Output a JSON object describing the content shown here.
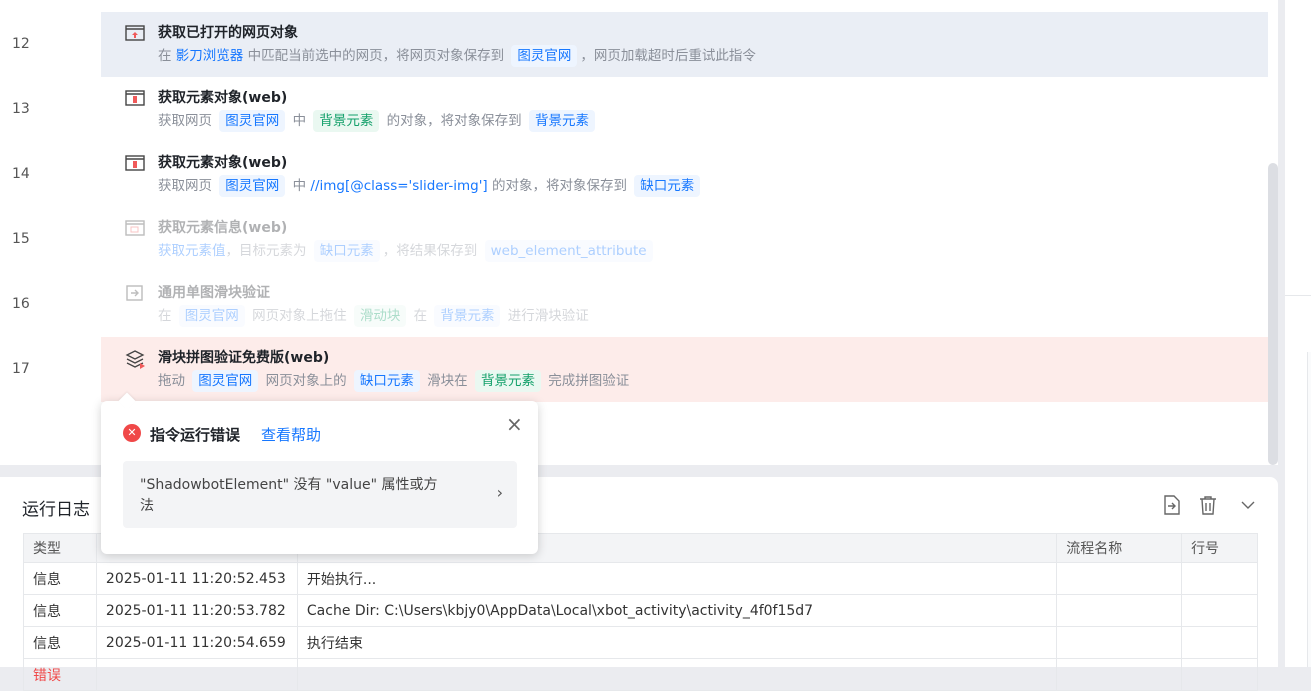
{
  "steps": [
    {
      "line": "12",
      "title": "获取已打开的网页对象",
      "desc": [
        {
          "t": "在 "
        },
        {
          "t": "影刀浏览器",
          "k": "lk"
        },
        {
          "t": " 中匹配当前选中的网页，将网页对象保存到 "
        },
        {
          "t": "图灵官网",
          "k": "tag"
        },
        {
          "t": "，网页加载超时后重试此指令"
        }
      ],
      "icon": "browser-icon",
      "state": "sel"
    },
    {
      "line": "13",
      "title": "获取元素对象(web)",
      "desc": [
        {
          "t": "获取网页 "
        },
        {
          "t": "图灵官网",
          "k": "tag"
        },
        {
          "t": " 中 "
        },
        {
          "t": "背景元素",
          "k": "tag g"
        },
        {
          "t": " 的对象，将对象保存到 "
        },
        {
          "t": "背景元素",
          "k": "tag"
        }
      ],
      "icon": "web-element-icon",
      "state": ""
    },
    {
      "line": "14",
      "title": "获取元素对象(web)",
      "desc": [
        {
          "t": "获取网页 "
        },
        {
          "t": "图灵官网",
          "k": "tag"
        },
        {
          "t": " 中 "
        },
        {
          "t": "//img[@class='slider-img']",
          "k": "lk"
        },
        {
          "t": " 的对象，将对象保存到 "
        },
        {
          "t": "缺口元素",
          "k": "tag"
        }
      ],
      "icon": "web-element-icon",
      "state": ""
    },
    {
      "line": "15",
      "title": "获取元素信息(web)",
      "desc": [
        {
          "t": "获取元素值",
          "k": "lk"
        },
        {
          "t": "，目标元素为 "
        },
        {
          "t": "缺口元素",
          "k": "tag"
        },
        {
          "t": "，将结果保存到 "
        },
        {
          "t": "web_element_attribute",
          "k": "tag"
        }
      ],
      "icon": "element-info-icon",
      "state": "dis"
    },
    {
      "line": "16",
      "title": "通用单图滑块验证",
      "desc": [
        {
          "t": "在 "
        },
        {
          "t": "图灵官网",
          "k": "tag"
        },
        {
          "t": " 网页对象上拖住 "
        },
        {
          "t": "滑动块",
          "k": "tag g"
        },
        {
          "t": " 在 "
        },
        {
          "t": "背景元素",
          "k": "tag"
        },
        {
          "t": " 进行滑块验证"
        }
      ],
      "icon": "slider-icon",
      "state": "dis"
    },
    {
      "line": "17",
      "title": "滑块拼图验证免费版(web)",
      "desc": [
        {
          "t": "拖动 "
        },
        {
          "t": "图灵官网",
          "k": "tag"
        },
        {
          "t": " 网页对象上的 "
        },
        {
          "t": "缺口元素",
          "k": "tag"
        },
        {
          "t": " 滑块在 "
        },
        {
          "t": "背景元素",
          "k": "tag g"
        },
        {
          "t": " 完成拼图验证"
        }
      ],
      "icon": "layers-icon",
      "state": "err"
    }
  ],
  "popup": {
    "title": "指令运行错误",
    "help": "查看帮助",
    "message": "\"ShadowbotElement\" 没有 \"value\" 属性或方法",
    "close": "×",
    "chev": "›"
  },
  "log": {
    "title": "运行日志",
    "columns": [
      "类型",
      "",
      "",
      "流程名称",
      "行号"
    ],
    "rows": [
      {
        "type": "信息",
        "time": "2025-01-11 11:20:52.453",
        "msg": "开始执行...",
        "flow": "",
        "line": ""
      },
      {
        "type": "信息",
        "time": "2025-01-11 11:20:53.782",
        "msg": "Cache Dir: C:\\Users\\kbjy0\\AppData\\Local\\xbot_activity\\activity_4f0f15d7",
        "flow": "",
        "line": ""
      },
      {
        "type": "信息",
        "time": "2025-01-11 11:20:54.659",
        "msg": "执行结束",
        "flow": "",
        "line": ""
      },
      {
        "type": "错误",
        "time": "",
        "msg": "",
        "flow": "",
        "line": ""
      }
    ]
  },
  "colors": {
    "accent": "#1677ff",
    "error": "#f04848",
    "selected": "#eaeef5",
    "error_row": "#fdecea"
  }
}
